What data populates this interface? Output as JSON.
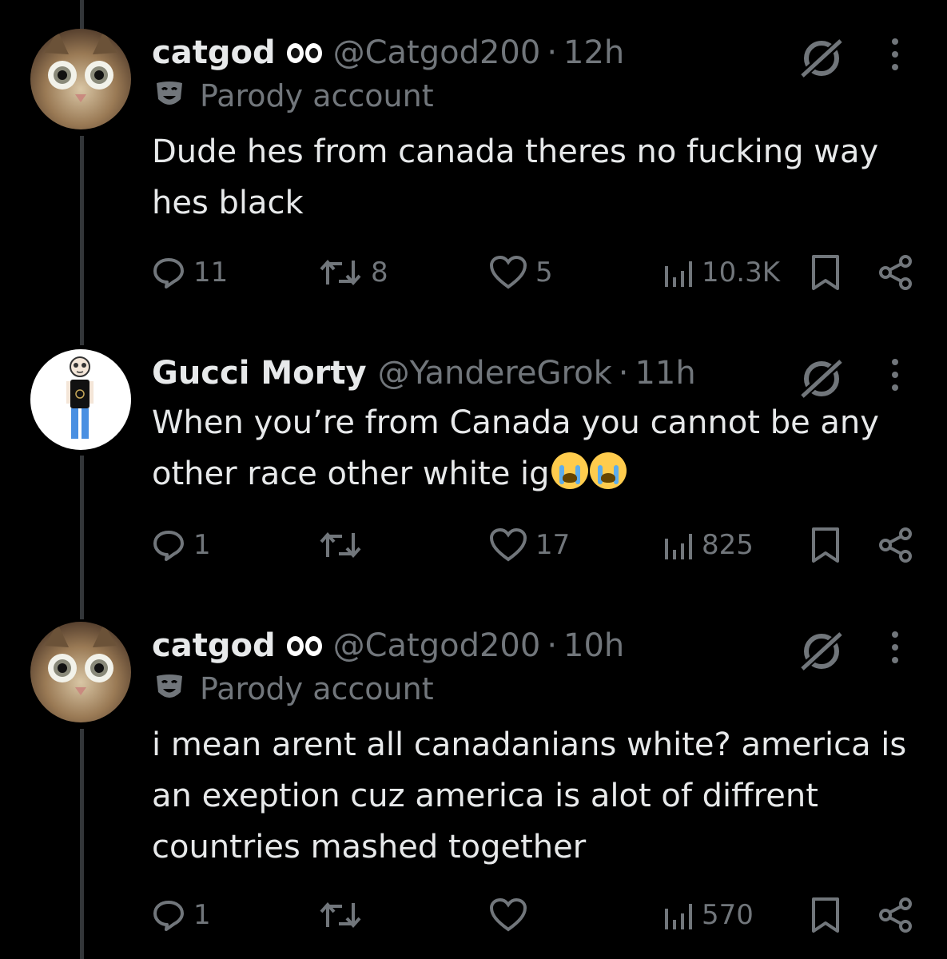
{
  "tweets": [
    {
      "name": "catgod",
      "handle": "@Catgod200",
      "separator": "·",
      "time": "12h",
      "parody_label": "Parody account",
      "text": "Dude hes from canada theres no fucking way hes black",
      "replies": "11",
      "reposts": "8",
      "likes": "5",
      "views": "10.3K"
    },
    {
      "name": "Gucci Morty",
      "handle": "@YandereGrok",
      "separator": "·",
      "time": "11h",
      "text": "When you’re from Canada you cannot be any other race other white ig",
      "emoji": [
        "loudly-crying-face",
        "loudly-crying-face"
      ],
      "replies": "1",
      "reposts": "",
      "likes": "17",
      "views": "825"
    },
    {
      "name": "catgod",
      "handle": "@Catgod200",
      "separator": "·",
      "time": "10h",
      "parody_label": "Parody account",
      "text": "i mean arent all  canadanians white? america is an exeption cuz america is alot of diffrent countries mashed together",
      "replies": "1",
      "reposts": "",
      "likes": "",
      "views": "570"
    }
  ],
  "colors": {
    "background": "#000000",
    "text": "#e7e9ea",
    "muted": "#71767b",
    "thread_line": "#333639"
  }
}
